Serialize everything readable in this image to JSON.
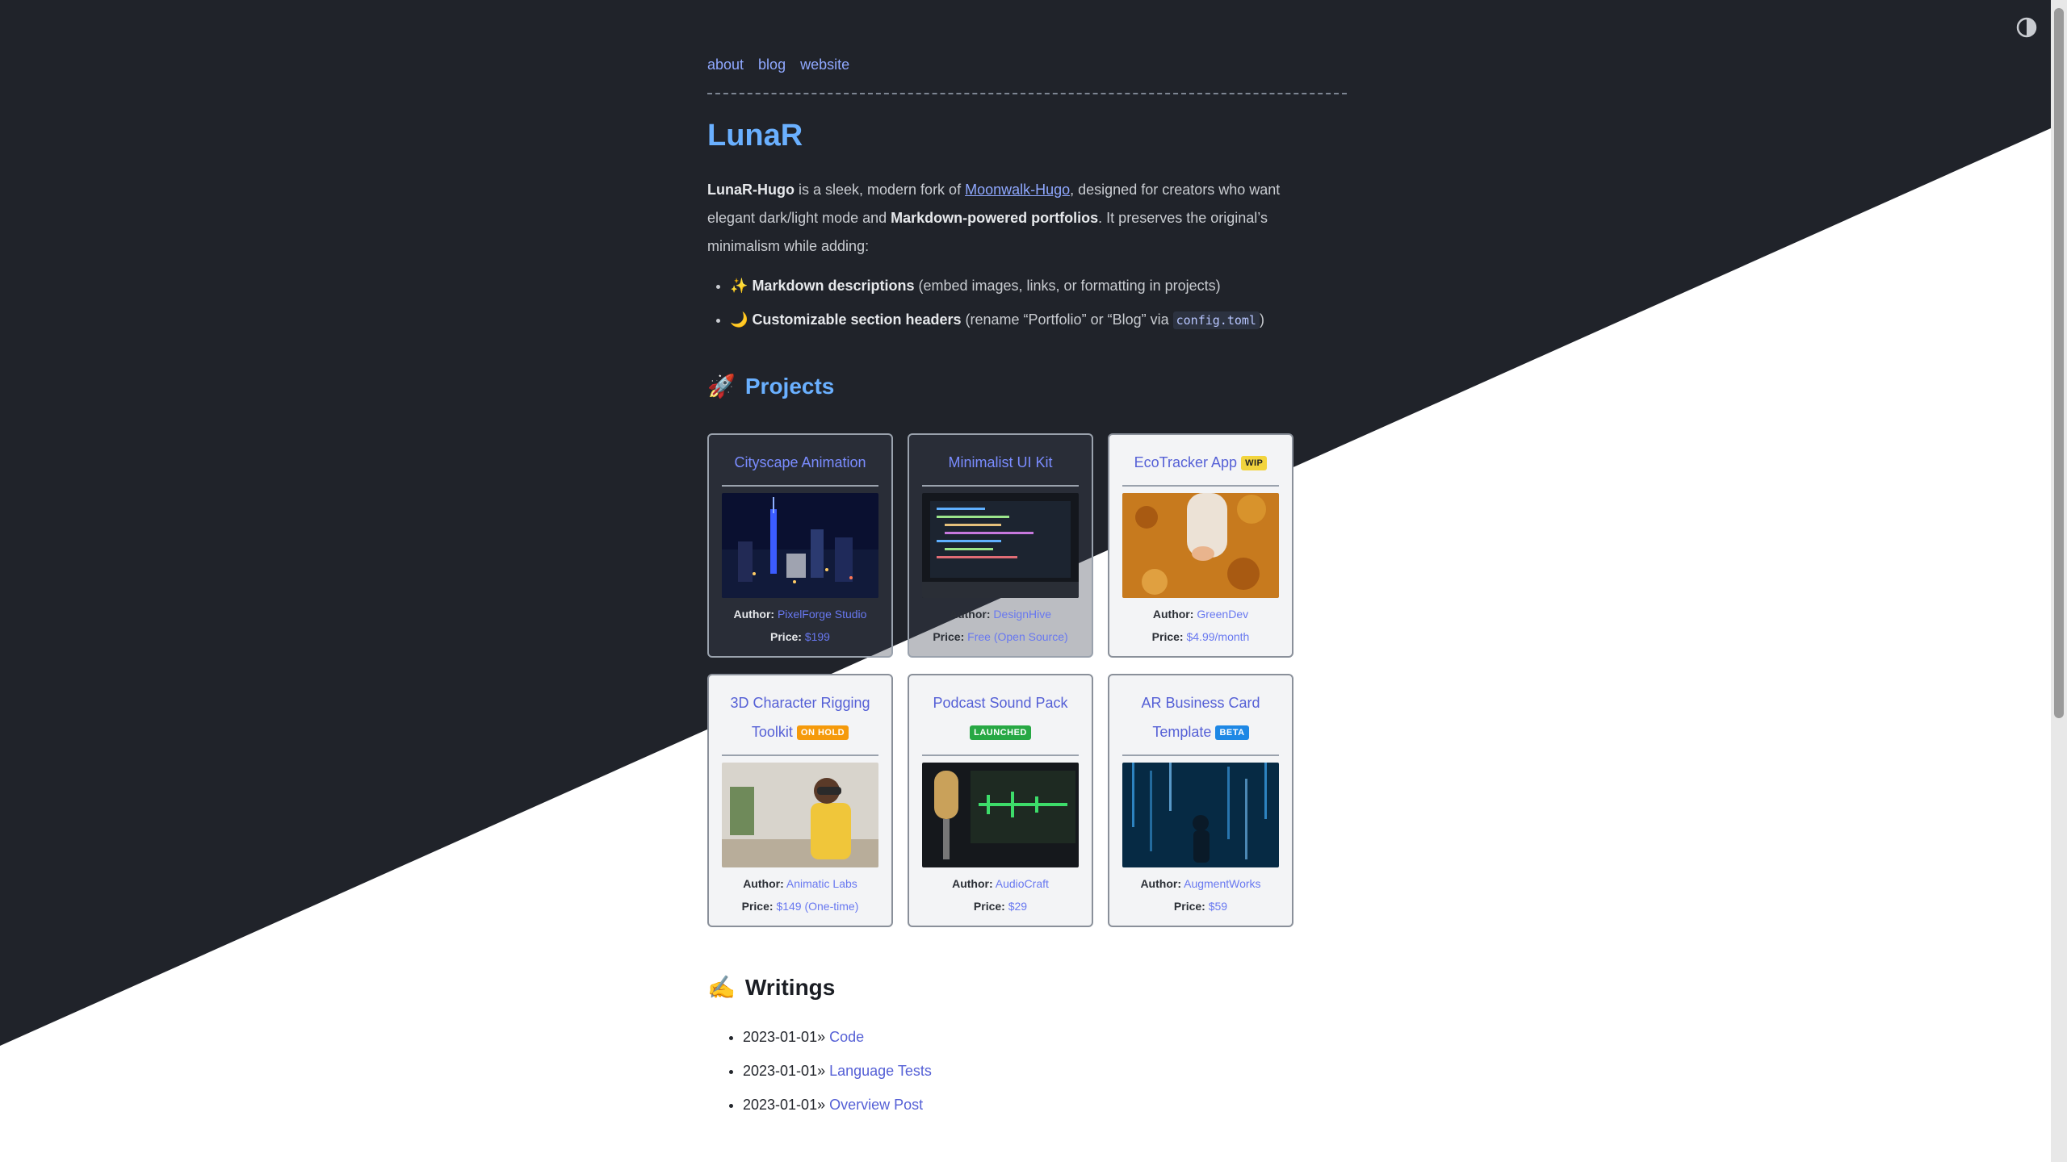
{
  "nav": {
    "items": [
      "about",
      "blog",
      "website"
    ]
  },
  "site_title": "LunaR",
  "intro": {
    "brand": "LunaR-Hugo",
    "t1": " is a sleek, modern fork of ",
    "link": "Moonwalk-Hugo",
    "t2": ", designed for creators who want elegant dark/light mode and ",
    "bold2": "Markdown-powered portfolios",
    "t3": ". It preserves the original’s minimalism while adding:"
  },
  "features": [
    {
      "emoji": "✨",
      "bold": "Markdown descriptions",
      "rest": " (embed images, links, or formatting in projects)"
    },
    {
      "emoji": "🌙",
      "bold": "Customizable section headers",
      "rest": " (rename “Portfolio” or “Blog” via ",
      "code": "config.toml",
      "tail": ")"
    }
  ],
  "projects_heading": {
    "emoji": "🚀",
    "label": "Projects"
  },
  "projects": [
    {
      "title": "Cityscape Animation",
      "badge": "",
      "author_label": "Author:",
      "author": "PixelForge Studio",
      "price_label": "Price:",
      "price": "$199"
    },
    {
      "title": "Minimalist UI Kit",
      "badge": "",
      "author_label": "Author:",
      "author": "DesignHive",
      "price_label": "Price:",
      "price": "Free (Open Source)"
    },
    {
      "title": "EcoTracker App",
      "badge": "WIP",
      "author_label": "Author:",
      "author": "GreenDev",
      "price_label": "Price:",
      "price": "$4.99/month"
    },
    {
      "title": "3D Character Rigging Toolkit",
      "badge": "ON HOLD",
      "author_label": "Author:",
      "author": "Animatic Labs",
      "price_label": "Price:",
      "price": "$149 (One-time)"
    },
    {
      "title": "Podcast Sound Pack",
      "badge": "LAUNCHED",
      "author_label": "Author:",
      "author": "AudioCraft",
      "price_label": "Price:",
      "price": "$29"
    },
    {
      "title": "AR Business Card Template",
      "badge": "BETA",
      "author_label": "Author:",
      "author": "AugmentWorks",
      "price_label": "Price:",
      "price": "$59"
    }
  ],
  "writings_heading": {
    "emoji": "✍️",
    "label": "Writings"
  },
  "writings": [
    {
      "date": "2023-01-01»",
      "title": "Code"
    },
    {
      "date": "2023-01-01»",
      "title": "Language Tests"
    },
    {
      "date": "2023-01-01»",
      "title": "Overview Post"
    }
  ],
  "colors": {
    "dark_bg": "#20232a",
    "light_bg": "#ffffff",
    "accent": "#6ab0ff",
    "link": "#8fa8ff"
  },
  "icons": {
    "theme_toggle": "half-circle-contrast-icon"
  }
}
